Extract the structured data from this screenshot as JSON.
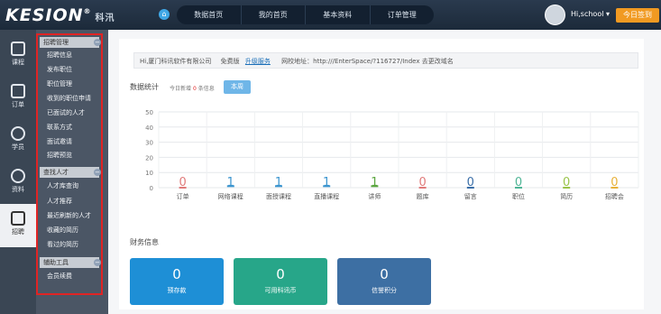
{
  "header": {
    "logo_text": "KESION",
    "logo_reg": "®",
    "logo_sub": "科汛",
    "nav": [
      "数据首页",
      "我的首页",
      "基本资料",
      "订单管理"
    ],
    "user": "Hi,school",
    "sign_button": "今日签到"
  },
  "left_nav": {
    "items": [
      {
        "label": "课程",
        "icon": "book-icon"
      },
      {
        "label": "订单",
        "icon": "order-icon"
      },
      {
        "label": "学员",
        "icon": "user-icon"
      },
      {
        "label": "资料",
        "icon": "gear-icon"
      },
      {
        "label": "招聘",
        "icon": "recruit-icon"
      }
    ]
  },
  "sub_nav": {
    "sections": [
      {
        "title": "招聘管理",
        "items": [
          "招聘信息",
          "发布职位",
          "职位管理",
          "收到的职位申请",
          "已面试的人才",
          "联系方式",
          "面试邀请",
          "招聘预览"
        ]
      },
      {
        "title": "查找人才",
        "items": [
          "人才库查询",
          "人才推荐",
          "最近刷新的人才",
          "收藏的简历",
          "看过的简历"
        ]
      },
      {
        "title": "辅助工具",
        "items": [
          "会员续费"
        ]
      }
    ]
  },
  "infobar": {
    "company": "Hi,厦门科讯软件有限公司",
    "version": "免费版",
    "upgrade": "升级服务",
    "url_label": "网校地址：http:///EnterSpace/?116727/Index 去更改域名"
  },
  "stats": {
    "title": "数据统计",
    "subtitle_prefix": "今日新增",
    "subtitle_count": "0",
    "subtitle_suffix": "条信息",
    "tab": "本周"
  },
  "chart_data": {
    "type": "bar",
    "categories": [
      "订单",
      "网络课程",
      "面授课程",
      "直播课程",
      "讲师",
      "题库",
      "留言",
      "职位",
      "简历",
      "招聘会"
    ],
    "values": [
      0,
      1,
      1,
      1,
      1,
      0,
      0,
      0,
      0,
      0
    ],
    "value_colors": [
      "#e07b7b",
      "#3b95cf",
      "#3b95cf",
      "#3b95cf",
      "#5aa63f",
      "#e07b7b",
      "#3b6fa8",
      "#4fb596",
      "#9ac44a",
      "#e8b23a"
    ],
    "ylim": [
      0,
      50
    ],
    "yticks": [
      0,
      10,
      20,
      30,
      40,
      50
    ]
  },
  "finance": {
    "title": "财务信息",
    "kpis": [
      {
        "value": "0",
        "label": "预存款",
        "color": "#1e8fd6"
      },
      {
        "value": "0",
        "label": "可用科讯币",
        "color": "#27a689"
      },
      {
        "value": "0",
        "label": "信誉积分",
        "color": "#3d6fa3"
      }
    ]
  }
}
